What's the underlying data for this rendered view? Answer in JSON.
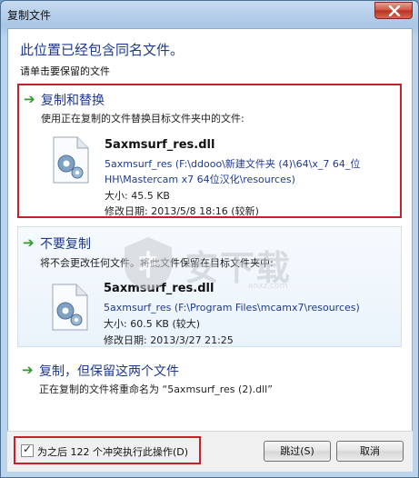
{
  "window": {
    "title": "复制文件"
  },
  "headline": "此位置已经包含同名文件。",
  "subline": "请单击要保留的文件",
  "options": [
    {
      "title": "复制和替换",
      "desc": "使用正在复制的文件替换目标文件夹中的文件:",
      "file": {
        "name": "5axmsurf_res.dll",
        "path1": "5axmsurf_res (F:\\ddooo\\新建文件夹 (4)\\64\\x_7 64_位",
        "path2": "HH\\Mastercam x7 64位汉化\\resources)",
        "size": "大小: 45.5 KB",
        "date": "修改日期: 2013/5/8 18:16 (较新)"
      }
    },
    {
      "title": "不要复制",
      "desc": "将不会更改任何文件。将此文件保留在目标文件夹中:",
      "file": {
        "name": "5axmsurf_res.dll",
        "path1": "5axmsurf_res (F:\\Program Files\\mcamx7\\resources)",
        "size": "大小: 60.5 KB (较大)",
        "date": "修改日期: 2013/3/27 21:25"
      }
    },
    {
      "title": "复制，但保留这两个文件",
      "desc": "正在复制的文件将重命名为 “5axmsurf_res (2).dll”"
    }
  ],
  "footer": {
    "checkbox_label": "为之后 122 个冲突执行此操作(D)",
    "checkbox_checked": "✓",
    "skip_label": "跳过(S)",
    "cancel_label": "取消"
  },
  "watermark": {
    "text": "安下载",
    "sub": "anxz.com"
  },
  "icons": [
    "close-icon",
    "green-arrow-icon",
    "dll-file-icon",
    "watermark-logo"
  ]
}
